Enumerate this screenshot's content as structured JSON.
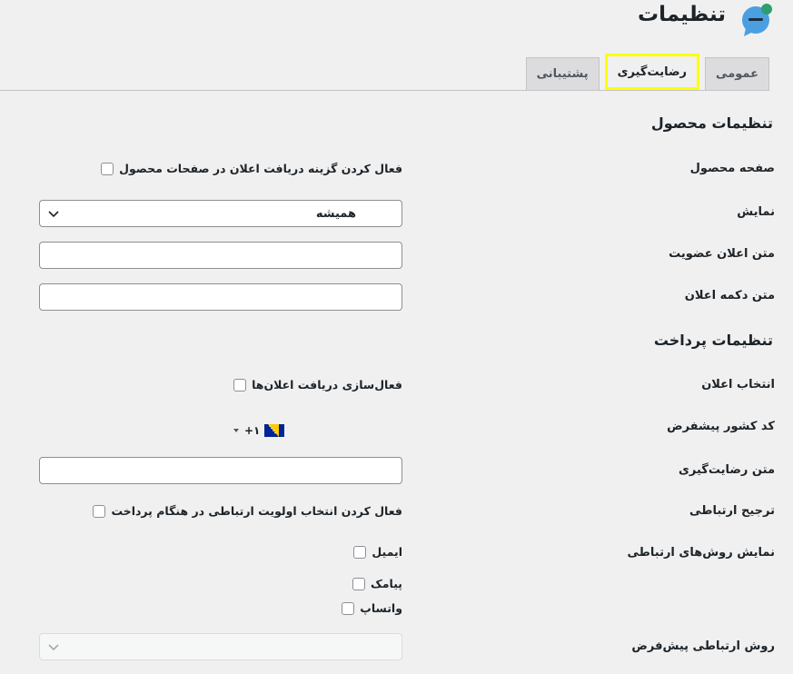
{
  "header": {
    "title": "تنظیمات",
    "logo_icon": "chat-bubble-icon",
    "accent": "#4a9fe0",
    "badge_color": "#2e9e6e"
  },
  "tabs": [
    {
      "label": "عمومی",
      "active": false
    },
    {
      "label": "رضایت‌گیری",
      "active": true
    },
    {
      "label": "پشتیبانی",
      "active": false
    }
  ],
  "product_settings": {
    "title": "تنظیمات محصول",
    "product_page_label": "صفحه محصول",
    "product_page_checkbox": "فعال کردن گزینه دریافت اعلان در صفحات محصول",
    "display_label": "نمایش",
    "display_value": "همیشه",
    "membership_text_label": "متن اعلان عضویت",
    "membership_text_value": "",
    "button_text_label": "متن دکمه اعلان",
    "button_text_value": ""
  },
  "payment_settings": {
    "title": "تنظیمات پرداخت",
    "notify_choice_label": "انتخاب اعلان",
    "notify_choice_checkbox": "فعال‌سازی دریافت اعلان‌ها",
    "country_code_label": "کد کشور پیشفرض",
    "country_code_value": "+۱",
    "satisfaction_text_label": "متن رضایت‌گیری",
    "satisfaction_text_value": "",
    "contact_pref_label": "ترجیح ارتباطی",
    "contact_pref_checkbox": "فعال کردن انتخاب اولویت ارتباطی در هنگام پرداخت",
    "contact_methods_label": "نمایش روش‌های ارتباطی",
    "contact_methods": [
      "ایمیل",
      "پیامک",
      "واتساپ"
    ],
    "default_method_label": "روش ارتباطی پیش‌فرض",
    "default_method_value": ""
  }
}
